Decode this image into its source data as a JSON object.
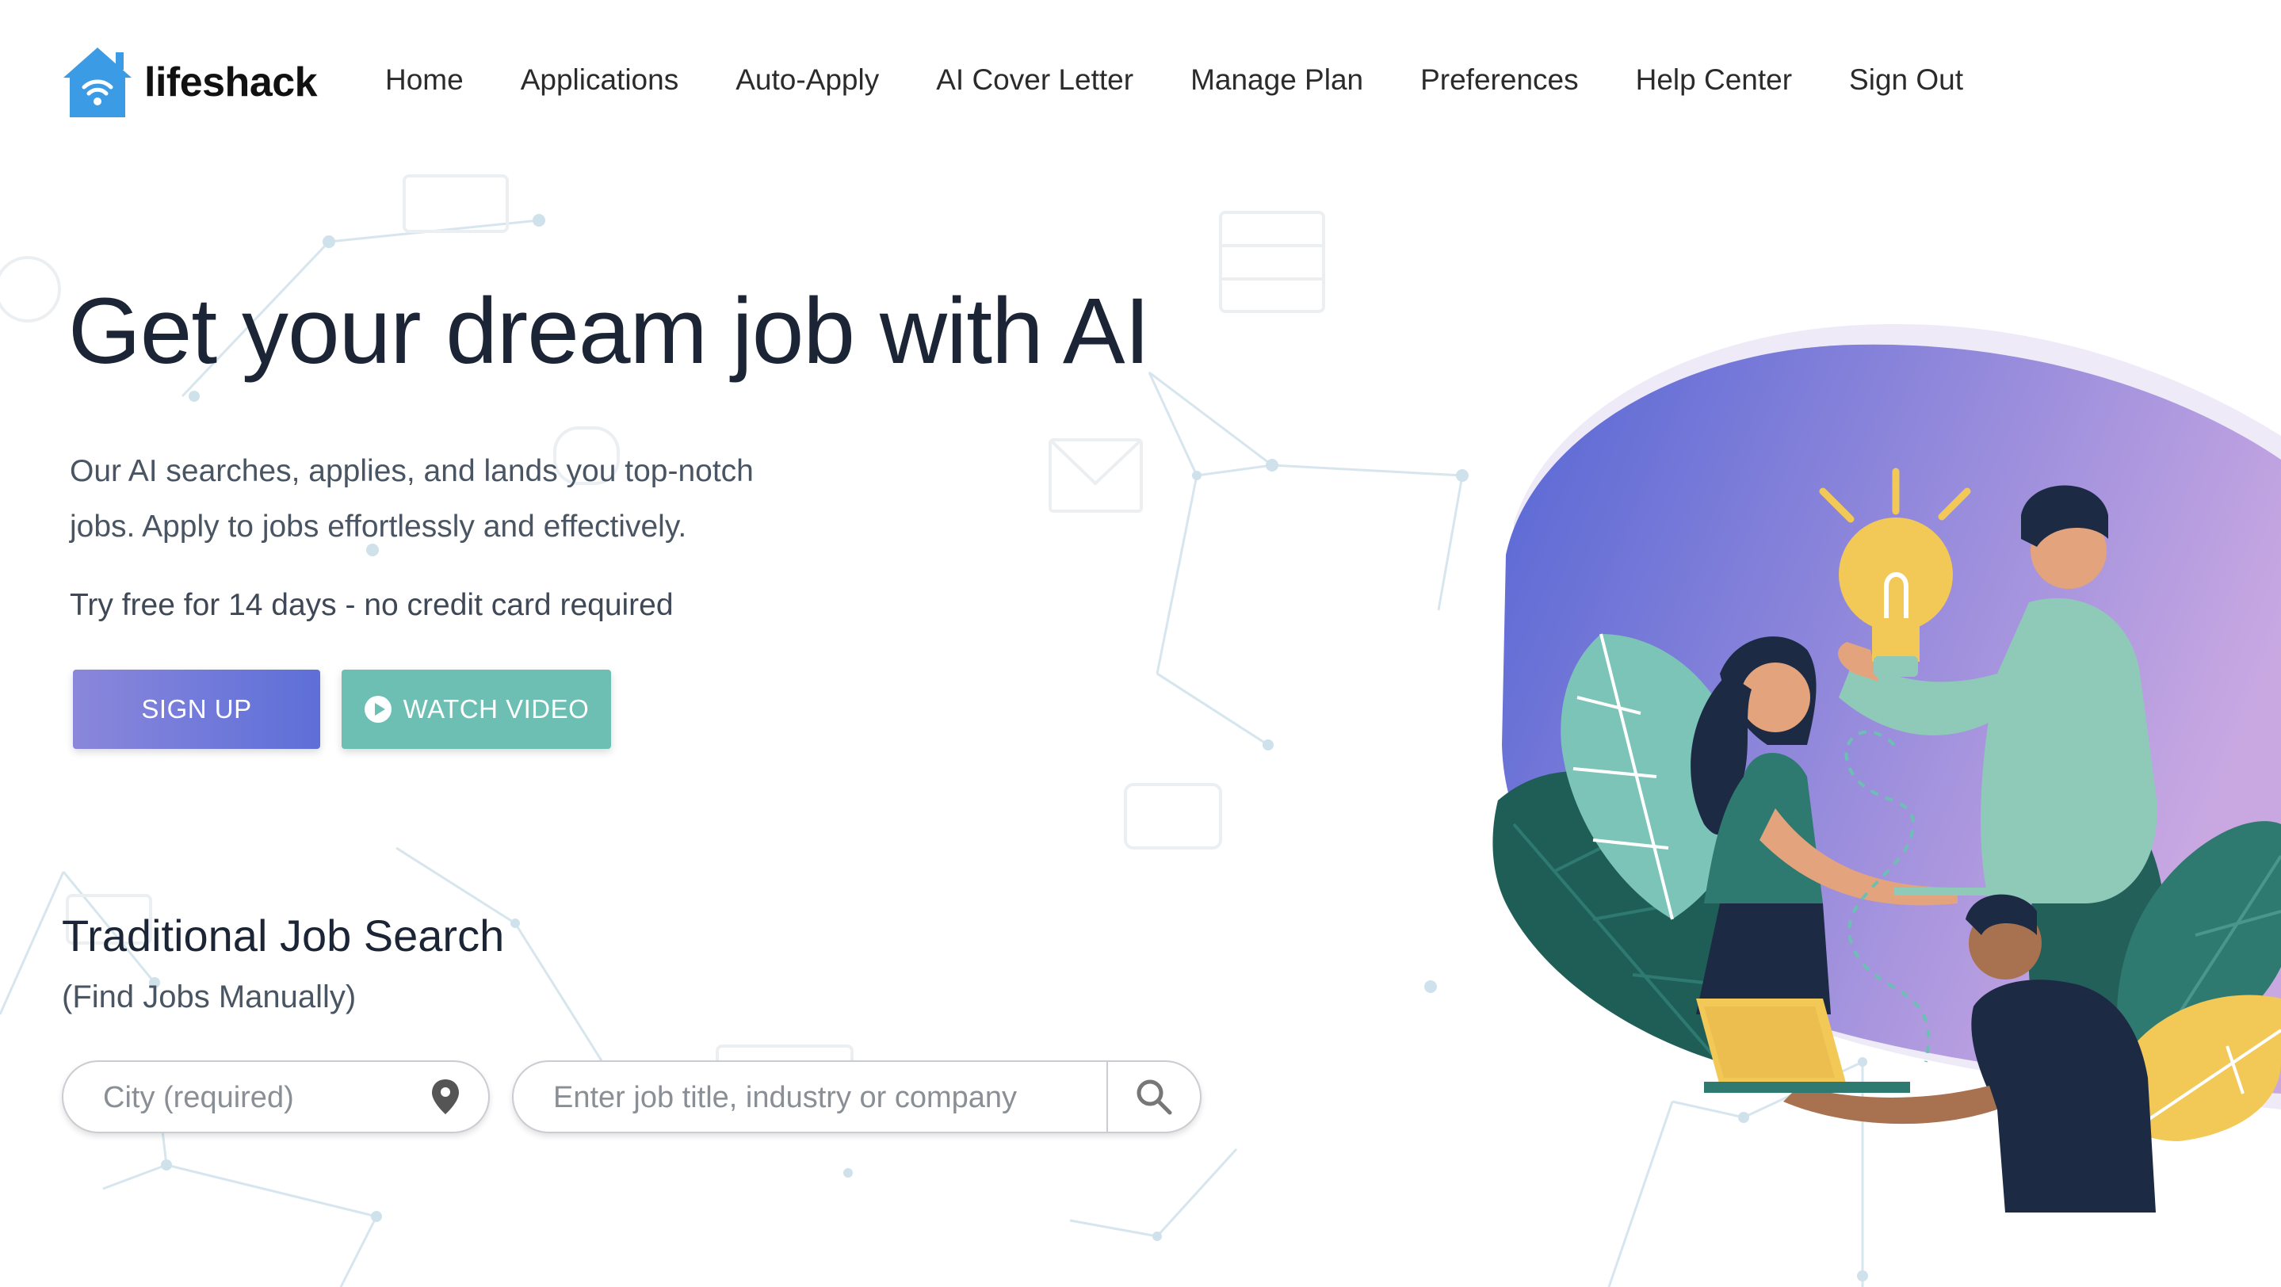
{
  "brand": {
    "name": "lifeshack",
    "logo_icon": "house-wifi-icon",
    "logo_color": "#3b9be4"
  },
  "nav": {
    "items": [
      {
        "label": "Home"
      },
      {
        "label": "Applications"
      },
      {
        "label": "Auto-Apply"
      },
      {
        "label": "AI Cover Letter"
      },
      {
        "label": "Manage Plan"
      },
      {
        "label": "Preferences"
      },
      {
        "label": "Help Center"
      },
      {
        "label": "Sign Out"
      }
    ]
  },
  "hero": {
    "title": "Get your dream job with AI",
    "subtitle_line1": "Our AI searches, applies, and lands you top-notch",
    "subtitle_line2": "jobs. Apply to jobs effortlessly and effectively.",
    "trial_text": "Try free for 14 days - no credit card required",
    "signup_label": "SIGN UP",
    "video_label": "WATCH VIDEO",
    "video_icon": "play-circle-icon",
    "signup_color": "#6f7bd9",
    "video_color": "#6dbfb4"
  },
  "traditional_search": {
    "title": "Traditional Job Search",
    "subtitle": "(Find Jobs Manually)",
    "city_placeholder": "City (required)",
    "city_value": "",
    "city_icon": "location-pin-icon",
    "job_placeholder": "Enter job title, industry or company",
    "job_value": "",
    "search_icon": "search-icon"
  },
  "illustration": {
    "description_icon": "team-idea-illustration",
    "blob_colors": [
      "#5b6bd6",
      "#c8a9e0"
    ]
  }
}
